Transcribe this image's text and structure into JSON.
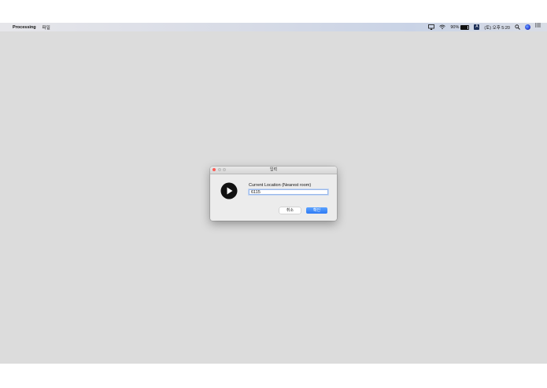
{
  "menubar": {
    "app_name": "Processing",
    "menu_file": "파일",
    "battery_percent": "90%",
    "battery_level": 0.9,
    "input_source": "A",
    "datetime": "(토) 오후 5:20",
    "icons": [
      "apple-icon",
      "airplay-icon",
      "wifi-icon",
      "battery-icon",
      "search-icon",
      "siri-icon",
      "notification-center-icon"
    ]
  },
  "dialog": {
    "title": "입력",
    "prompt": "Current Location (Nearest room)",
    "input_value": "6115",
    "cancel_label": "취소",
    "ok_label": "확인",
    "icon": "play-icon"
  },
  "colors": {
    "desktop": "#dcdcdc",
    "ok_button": "#2f7bf5",
    "close_light": "#fc5d57"
  }
}
